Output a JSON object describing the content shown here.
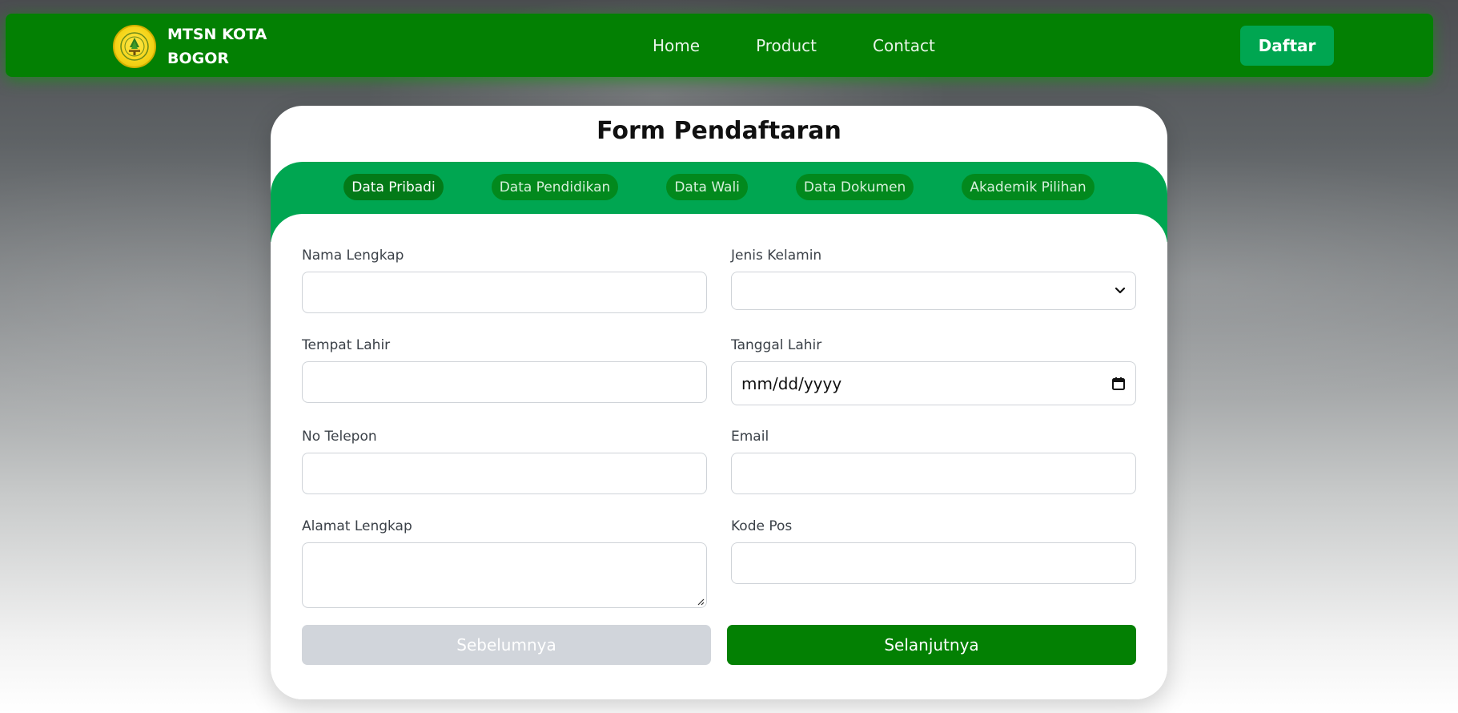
{
  "brand": {
    "name_line1": "MTSN KOTA",
    "name_line2": "BOGOR"
  },
  "nav": {
    "links": [
      "Home",
      "Product",
      "Contact"
    ],
    "cta": "Daftar"
  },
  "form": {
    "title": "Form Pendaftaran",
    "tabs": [
      "Data Pribadi",
      "Data Pendidikan",
      "Data Wali",
      "Data Dokumen",
      "Akademik Pilihan"
    ],
    "active_tab": "Data Pribadi",
    "fields": {
      "nama_lengkap": {
        "label": "Nama Lengkap",
        "value": ""
      },
      "jenis_kelamin": {
        "label": "Jenis Kelamin",
        "value": ""
      },
      "tempat_lahir": {
        "label": "Tempat Lahir",
        "value": ""
      },
      "tanggal_lahir": {
        "label": "Tanggal Lahir",
        "placeholder": "mm/dd/yyyy"
      },
      "no_telepon": {
        "label": "No Telepon",
        "value": ""
      },
      "email": {
        "label": "Email",
        "value": ""
      },
      "alamat_lengkap": {
        "label": "Alamat Lengkap",
        "value": ""
      },
      "kode_pos": {
        "label": "Kode Pos",
        "value": ""
      }
    },
    "buttons": {
      "prev": "Sebelumnya",
      "next": "Selanjutnya"
    }
  },
  "colors": {
    "nav_green": "#038003",
    "accent_green": "#00a651",
    "disabled_gray": "#d1d5db"
  },
  "icons": [
    "school-emblem-icon",
    "chevron-down-icon",
    "calendar-icon",
    "resize-handle-icon"
  ]
}
